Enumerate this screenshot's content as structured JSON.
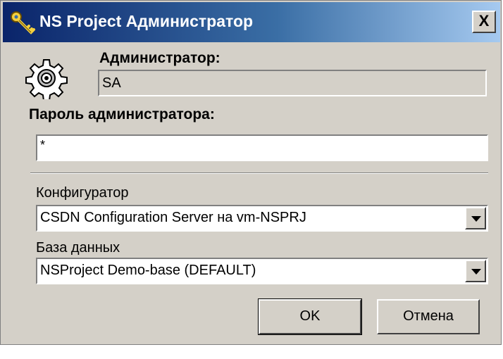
{
  "window": {
    "title": "NS Project Администратор",
    "close_label": "X"
  },
  "admin": {
    "label": "Администратор:",
    "value": "SA"
  },
  "password": {
    "label": "Пароль администратора:",
    "value": "*"
  },
  "configurator": {
    "label": "Конфигуратор",
    "selected": "CSDN Configuration Server на vm-NSPRJ"
  },
  "database": {
    "label": "База данных",
    "selected": "NSProject Demo-base (DEFAULT)"
  },
  "buttons": {
    "ok_label": "OK",
    "cancel_label": "Отмена"
  },
  "icons": {
    "title": "keys-icon",
    "main": "gear-icon",
    "combo": "dropdown-arrow-icon"
  },
  "colors": {
    "title_start": "#0a246a",
    "title_end": "#a6caf0",
    "face": "#d4d0c8"
  }
}
